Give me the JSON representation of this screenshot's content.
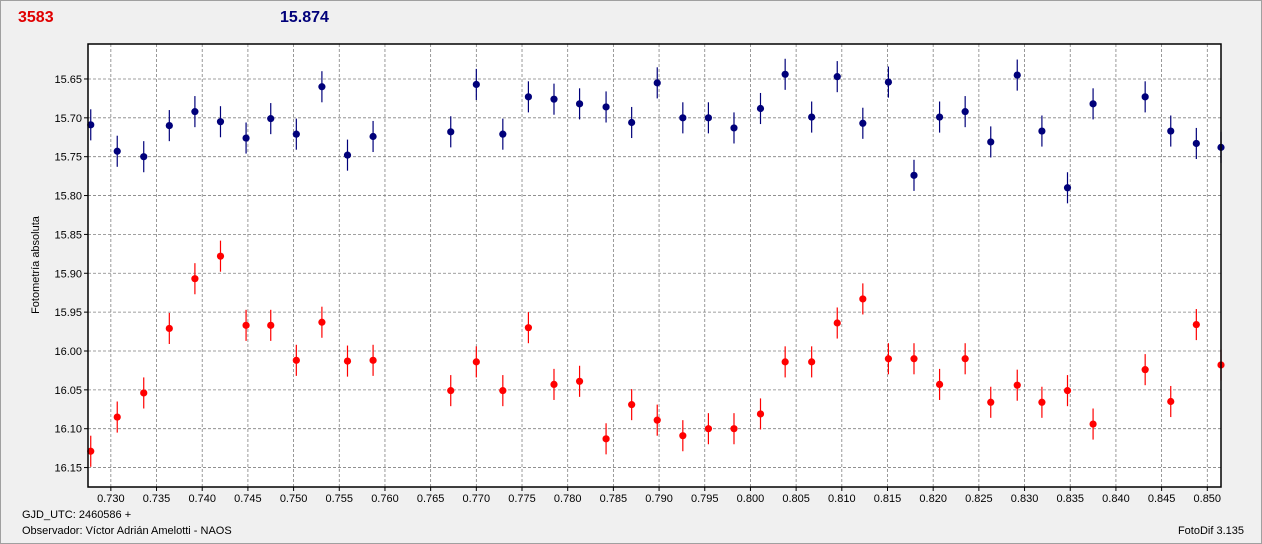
{
  "header": {
    "left_value": "3583",
    "left_color": "#e00000",
    "mid_value": "15.874",
    "mid_color": "#00007a"
  },
  "footer": {
    "gjd": "GJD_UTC: 2460586 +",
    "observer": "Observador: Víctor Adrián Amelotti - NAOS",
    "software": "FotoDif 3.135"
  },
  "chart_data": {
    "type": "scatter",
    "ylabel": "Fotometría absoluta",
    "xlabel": "",
    "xlim": [
      0.7275,
      0.8515
    ],
    "ylim": [
      16.175,
      15.605
    ],
    "y_inverted": true,
    "grid": true,
    "grid_style": "dashed",
    "x_ticks": [
      "0.730",
      "0.735",
      "0.740",
      "0.745",
      "0.750",
      "0.755",
      "0.760",
      "0.765",
      "0.770",
      "0.775",
      "0.780",
      "0.785",
      "0.790",
      "0.795",
      "0.800",
      "0.805",
      "0.810",
      "0.815",
      "0.820",
      "0.825",
      "0.830",
      "0.835",
      "0.840",
      "0.845",
      "0.850"
    ],
    "y_ticks": [
      "15.65",
      "15.70",
      "15.75",
      "15.80",
      "15.85",
      "15.90",
      "15.95",
      "16.00",
      "16.05",
      "16.10",
      "16.15"
    ],
    "error_bar": 0.02,
    "series": [
      {
        "color": "#00007a",
        "x": [
          0.7278,
          0.7307,
          0.7336,
          0.7364,
          0.7392,
          0.742,
          0.7448,
          0.7475,
          0.7503,
          0.7531,
          0.7559,
          0.7587,
          0.7672,
          0.77,
          0.7729,
          0.7757,
          0.7785,
          0.7813,
          0.7842,
          0.787,
          0.7898,
          0.7926,
          0.7954,
          0.7982,
          0.8011,
          0.8038,
          0.8067,
          0.8095,
          0.8123,
          0.8151,
          0.8179,
          0.8207,
          0.8235,
          0.8263,
          0.8292,
          0.8319,
          0.8347,
          0.8375,
          0.8432,
          0.846,
          0.8488,
          0.8515
        ],
        "y": [
          15.709,
          15.743,
          15.75,
          15.71,
          15.692,
          15.705,
          15.726,
          15.701,
          15.721,
          15.66,
          15.748,
          15.724,
          15.718,
          15.657,
          15.721,
          15.673,
          15.676,
          15.682,
          15.686,
          15.706,
          15.655,
          15.7,
          15.7,
          15.713,
          15.688,
          15.644,
          15.699,
          15.647,
          15.707,
          15.654,
          15.774,
          15.699,
          15.692,
          15.731,
          15.645,
          15.717,
          15.79,
          15.682,
          15.673,
          15.717,
          15.733,
          15.738
        ]
      },
      {
        "color": "#ff0000",
        "x": [
          0.7278,
          0.7307,
          0.7336,
          0.7364,
          0.7392,
          0.742,
          0.7448,
          0.7475,
          0.7503,
          0.7531,
          0.7559,
          0.7587,
          0.7672,
          0.77,
          0.7729,
          0.7757,
          0.7785,
          0.7813,
          0.7842,
          0.787,
          0.7898,
          0.7926,
          0.7954,
          0.7982,
          0.8011,
          0.8038,
          0.8067,
          0.8095,
          0.8123,
          0.8151,
          0.8179,
          0.8207,
          0.8235,
          0.8263,
          0.8292,
          0.8319,
          0.8347,
          0.8375,
          0.8432,
          0.846,
          0.8488,
          0.8515
        ],
        "y": [
          16.129,
          16.085,
          16.054,
          15.971,
          15.907,
          15.878,
          15.967,
          15.967,
          16.012,
          15.963,
          16.013,
          16.012,
          16.051,
          16.014,
          16.051,
          15.97,
          16.043,
          16.039,
          16.113,
          16.069,
          16.089,
          16.109,
          16.1,
          16.1,
          16.081,
          16.014,
          16.014,
          15.964,
          15.933,
          16.01,
          16.01,
          16.043,
          16.01,
          16.066,
          16.044,
          16.066,
          16.051,
          16.094,
          16.024,
          16.065,
          15.966,
          16.018
        ]
      }
    ]
  }
}
